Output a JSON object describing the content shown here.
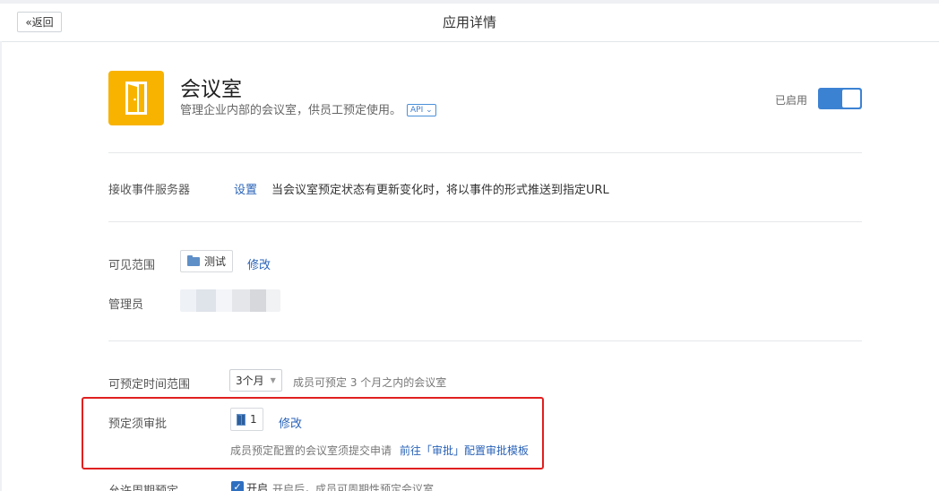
{
  "header": {
    "back_label": "返回",
    "title": "应用详情"
  },
  "app": {
    "name": "会议室",
    "description": "管理企业内部的会议室，供员工预定使用。",
    "api_tag": "API",
    "enabled_label": "已启用",
    "enabled": true,
    "icon_color": "#f8b300"
  },
  "event_server": {
    "label": "接收事件服务器",
    "setting_link": "设置",
    "description": "当会议室预定状态有更新变化时，将以事件的形式推送到指定URL"
  },
  "visibility": {
    "label": "可见范围",
    "scope_chip": "测试",
    "modify_link": "修改"
  },
  "admin": {
    "label": "管理员"
  },
  "booking_range": {
    "label": "可预定时间范围",
    "selected": "3个月",
    "hint": "成员可预定 3 个月之内的会议室"
  },
  "approval": {
    "label": "预定须审批",
    "count": "1",
    "modify_link": "修改",
    "hint": "成员预定配置的会议室须提交申请",
    "goto_prefix": "前往「审批」配置审批模板"
  },
  "recurring": {
    "label": "允许周期预定",
    "checkbox_label": "开启",
    "hint": "开启后，成员可周期性预定会议室",
    "checked": true
  }
}
